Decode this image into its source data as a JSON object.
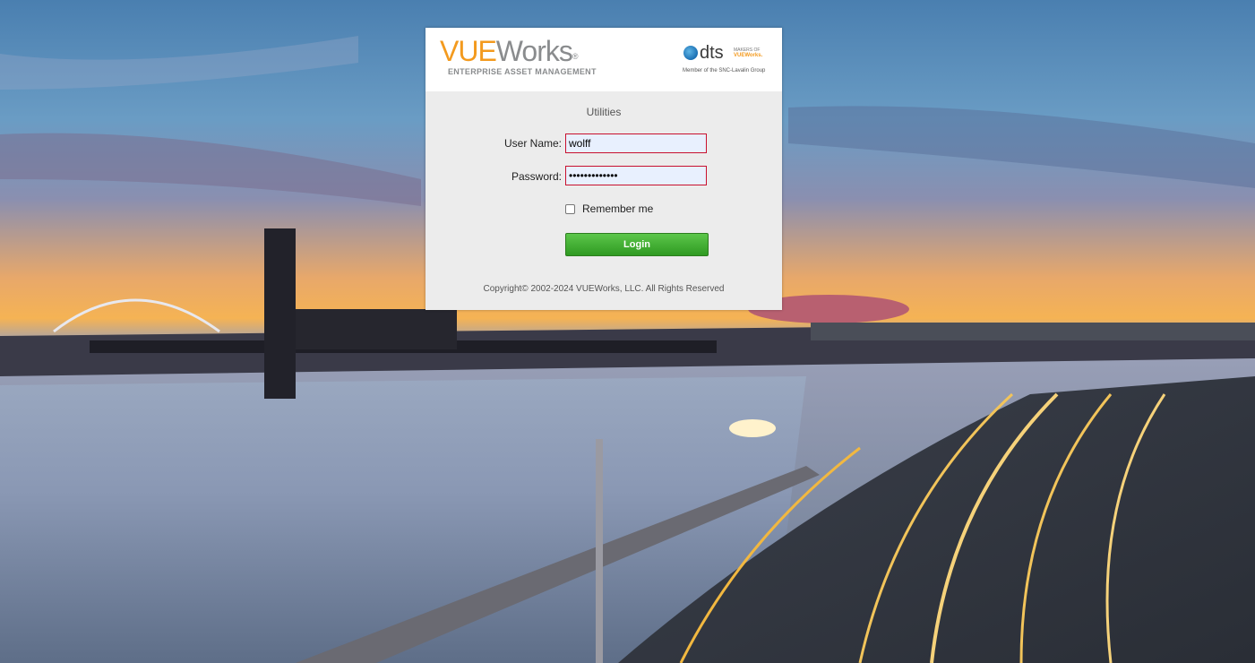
{
  "app": {
    "logo_vue": "VUE",
    "logo_works": "Works",
    "logo_reg": "®",
    "logo_tagline": "ENTERPRISE ASSET MANAGEMENT",
    "partner_name": "dts",
    "partner_makers": "MAKERS OF",
    "partner_makers_brand": "VUEWorks.",
    "partner_member": "Member of the SNC-Lavalin Group",
    "subtitle": "Utilities"
  },
  "form": {
    "username_label": "User Name:",
    "username_value": "wolff",
    "password_label": "Password:",
    "password_value": "•••••••••••••",
    "remember_label": "Remember me",
    "login_label": "Login"
  },
  "footer": {
    "copyright": "Copyright© 2002-2024 VUEWorks, LLC. All Rights Reserved"
  },
  "colors": {
    "brand_orange": "#f39a1e",
    "brand_gray": "#8a8c8e",
    "login_green": "#3aa82b",
    "field_border": "#c8102e"
  }
}
